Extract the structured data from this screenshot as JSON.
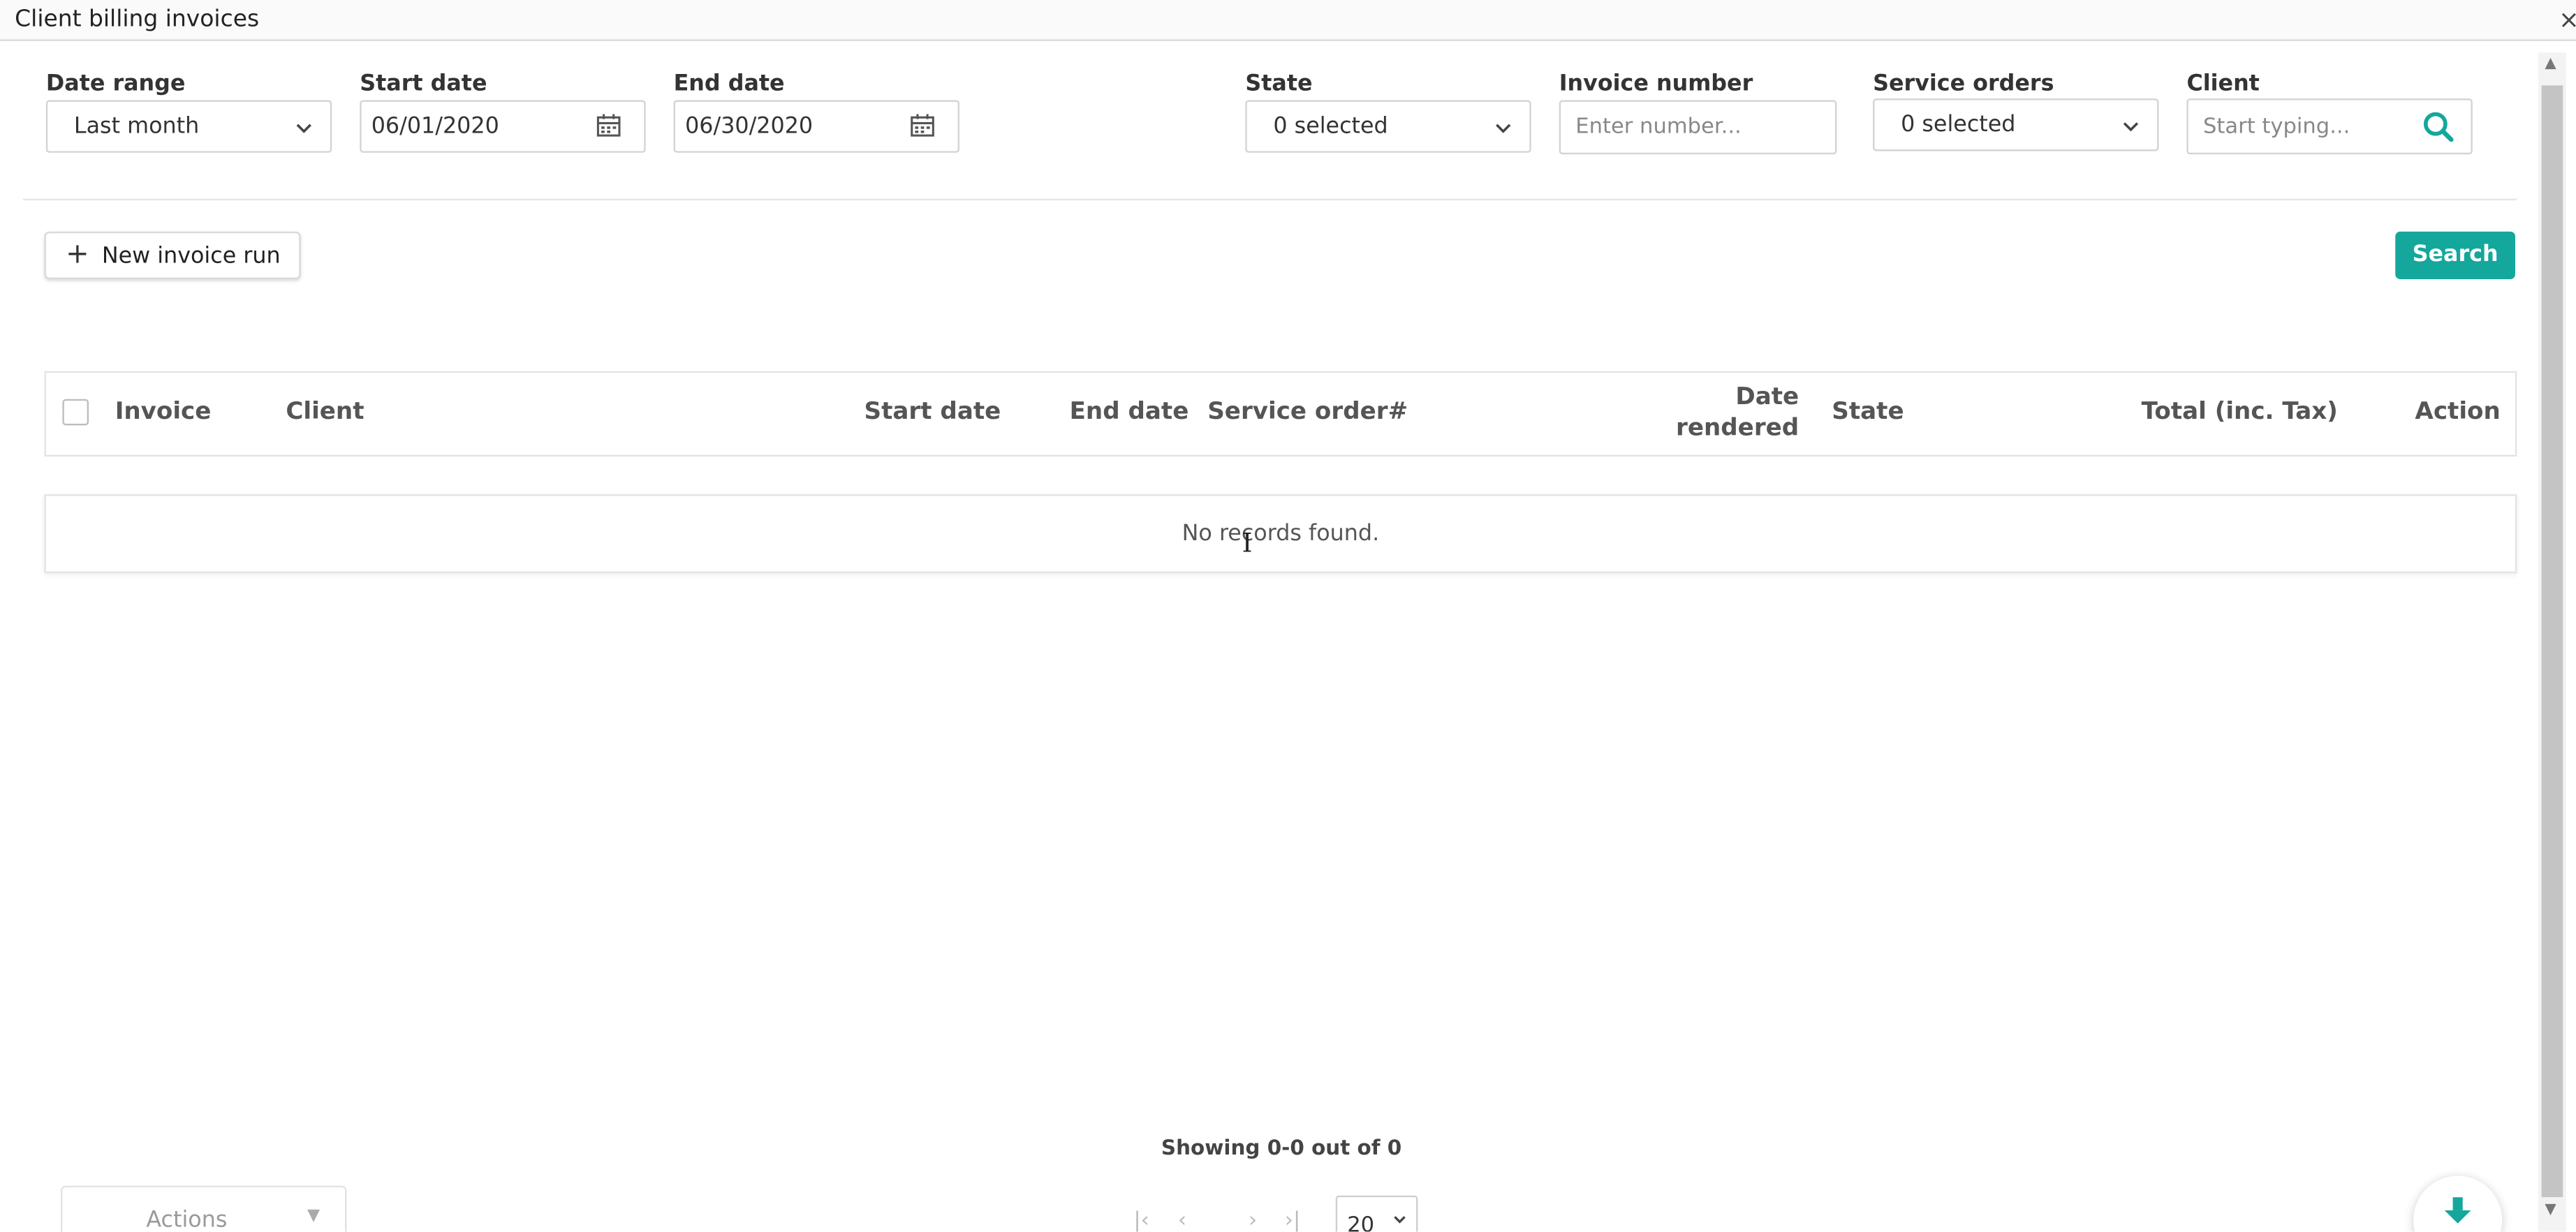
{
  "window": {
    "title": "Client billing invoices",
    "close_icon": "×"
  },
  "filters": {
    "date_range": {
      "label": "Date range",
      "value": "Last month"
    },
    "start_date": {
      "label": "Start date",
      "value": "06/01/2020"
    },
    "end_date": {
      "label": "End date",
      "value": "06/30/2020"
    },
    "state": {
      "label": "State",
      "value": "0 selected"
    },
    "invoice_number": {
      "label": "Invoice number",
      "placeholder": "Enter number..."
    },
    "service_orders": {
      "label": "Service orders",
      "value": "0 selected"
    },
    "client": {
      "label": "Client",
      "placeholder": "Start typing..."
    }
  },
  "toolbar": {
    "new_invoice_run": "New invoice run",
    "search": "Search"
  },
  "table": {
    "columns": {
      "invoice": "Invoice",
      "client": "Client",
      "start_date": "Start date",
      "end_date": "End date",
      "service_order": "Service order#",
      "date_rendered_1": "Date",
      "date_rendered_2": "rendered",
      "state": "State",
      "total": "Total (inc. Tax)",
      "action": "Action"
    },
    "empty_message": "No records found."
  },
  "footer": {
    "showing": "Showing 0-0 out of 0",
    "actions_label": "Actions",
    "page_size": "20"
  },
  "colors": {
    "accent": "#14a79c",
    "border": "#d3d3d3"
  },
  "icons": [
    "close-icon",
    "chevron-down-icon",
    "calendar-icon",
    "search-icon",
    "plus-icon",
    "download-icon",
    "first-page-icon",
    "prev-page-icon",
    "next-page-icon",
    "last-page-icon"
  ]
}
